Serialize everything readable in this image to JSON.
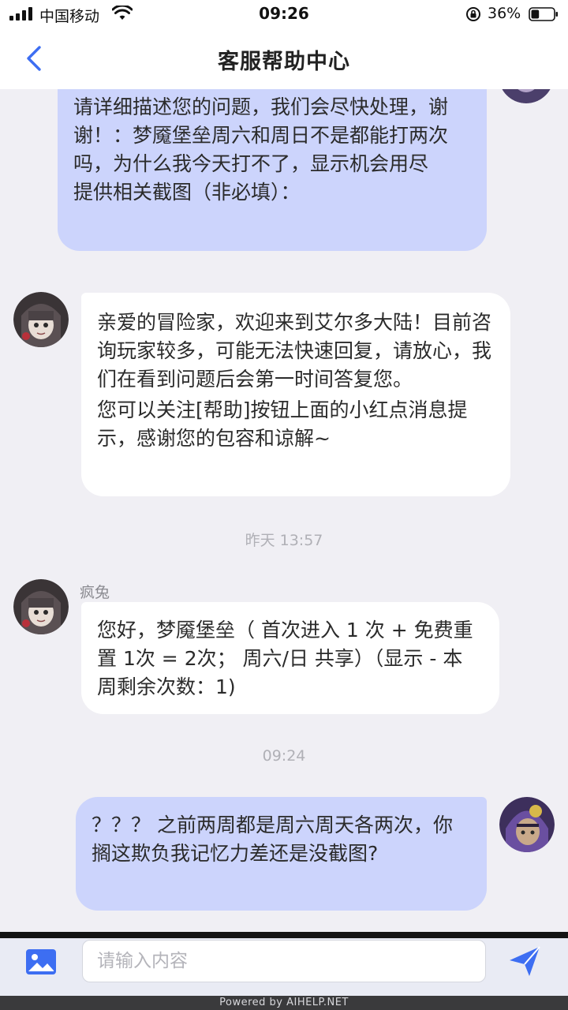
{
  "status_bar": {
    "carrier": "中国移动",
    "time": "09:26",
    "battery": "36%",
    "battery_level": 0.36,
    "icons": [
      "signal-icon",
      "wifi-icon",
      "orientation-lock-icon",
      "battery-icon"
    ]
  },
  "header": {
    "title": "客服帮助中心",
    "back_icon": "chevron-left-icon"
  },
  "messages": [
    {
      "from": "user",
      "lines": [
        "请详细描述您的问题，我们会尽快处理，谢谢！：梦魇堡垒周六和周日不是都能打两次吗，为什么我今天打不了，显示机会用尽",
        "提供相关截图（非必填）："
      ]
    },
    {
      "from": "agent",
      "lines": [
        "亲爱的冒险家，欢迎来到艾尔多大陆！目前咨询玩家较多，可能无法快速回复，请放心，我们在看到问题后会第一时间答复您。",
        "您可以关注[帮助]按钮上面的小红点消息提示，感谢您的包容和谅解~"
      ]
    },
    {
      "timestamp": "昨天 13:57"
    },
    {
      "from": "agent",
      "sender": "疯兔",
      "lines": [
        "您好，梦魇堡垒（ 首次进入 1 次 + 免费重置 1次 = 2次； 周六/日 共享）（显示 - 本周剩余次数：1)"
      ]
    },
    {
      "timestamp": "09:24"
    },
    {
      "from": "user",
      "lines": [
        "？？？ 之前两周都是周六周天各两次，你搁这欺负我记忆力差还是没截图?"
      ]
    }
  ],
  "input_bar": {
    "placeholder": "请输入内容",
    "image_icon": "image-icon",
    "send_icon": "send-icon"
  },
  "footer": {
    "text": "Powered by AIHELP.NET"
  },
  "colors": {
    "user_bubble": "#ccd4fc",
    "agent_bubble": "#ffffff",
    "accent": "#3d6ef2",
    "background": "#f0eff4"
  }
}
